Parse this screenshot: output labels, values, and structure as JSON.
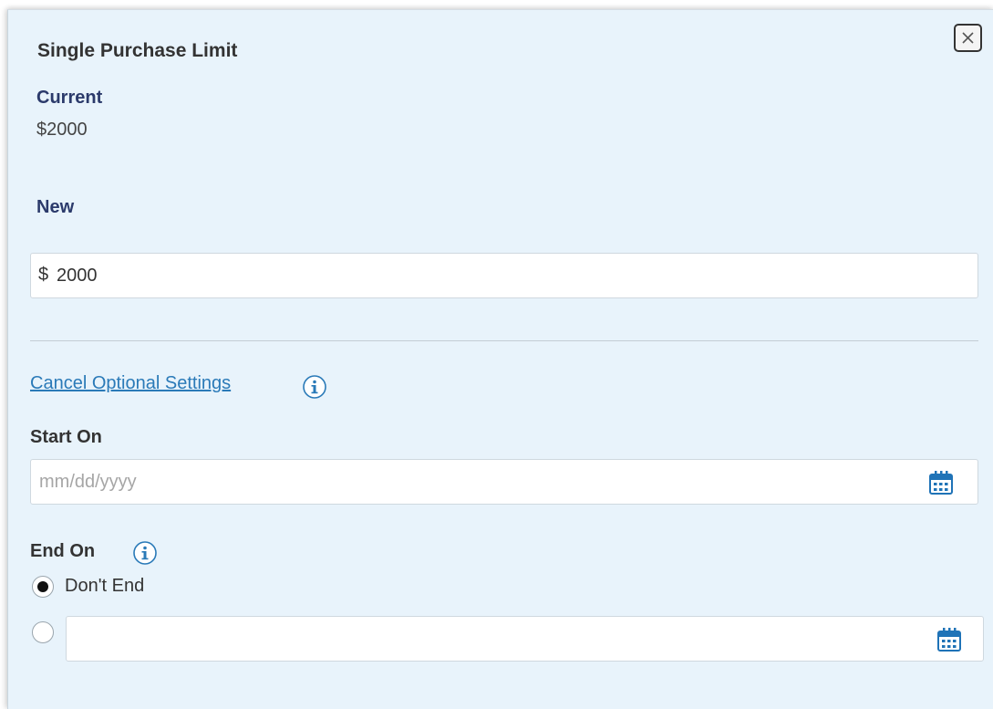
{
  "dialog": {
    "title": "Single Purchase Limit",
    "current": {
      "label": "Current",
      "value": "$2000"
    },
    "new": {
      "label": "New",
      "currency_symbol": "$",
      "amount_value": "2000"
    },
    "cancel_optional_link": "Cancel Optional Settings",
    "start_on": {
      "label": "Start On",
      "placeholder": "mm/dd/yyyy",
      "value": ""
    },
    "end_on": {
      "label": "End On",
      "dont_end_label": "Don't End",
      "dont_end_selected": true,
      "end_date_value": ""
    }
  },
  "icons": {
    "close": "close-icon",
    "info": "info-icon",
    "calendar": "calendar-icon"
  },
  "colors": {
    "panel_background": "#e8f3fb",
    "link": "#2a7ab8",
    "label_blue": "#2b3a6b",
    "icon_blue": "#1f73b7"
  }
}
